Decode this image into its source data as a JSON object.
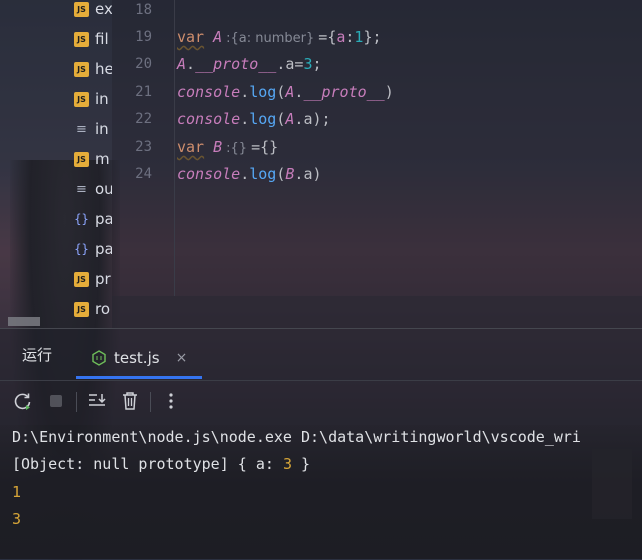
{
  "project_tree": {
    "items": [
      {
        "icon": "js",
        "label": "ex"
      },
      {
        "icon": "js",
        "label": "fil"
      },
      {
        "icon": "js",
        "label": "he"
      },
      {
        "icon": "js",
        "label": "in"
      },
      {
        "icon": "text",
        "label": "in"
      },
      {
        "icon": "js",
        "label": "m"
      },
      {
        "icon": "text",
        "label": "ou"
      },
      {
        "icon": "json",
        "label": "pa"
      },
      {
        "icon": "json",
        "label": "pa"
      },
      {
        "icon": "js",
        "label": "pr"
      },
      {
        "icon": "js",
        "label": "ro"
      }
    ],
    "js_badge": "JS"
  },
  "editor": {
    "line_numbers": [
      "18",
      "19",
      "20",
      "21",
      "22",
      "23",
      "24"
    ],
    "lines": {
      "l19": {
        "kw": "var",
        "name": "A",
        "hint": ":{a: number}",
        "eq": "={",
        "prop": "a",
        "colon": ":",
        "num": "1",
        "tail": "};"
      },
      "l20": {
        "name": "A",
        "dot": ".",
        "proto": "__proto__",
        "dot2": ".",
        "prop": "a",
        "eq": "=",
        "num": "3",
        "tail": ";"
      },
      "l21": {
        "obj": "console",
        "dot": ".",
        "fn": "log",
        "open": "(",
        "name": "A",
        "dot2": ".",
        "proto": "__proto__",
        "close": ")"
      },
      "l22": {
        "obj": "console",
        "dot": ".",
        "fn": "log",
        "open": "(",
        "name": "A",
        "dot2": ".",
        "prop": "a",
        "close": ");"
      },
      "l23": {
        "kw": "var",
        "name": "B",
        "hint": ":{}",
        "eq": "={}"
      },
      "l24": {
        "obj": "console",
        "dot": ".",
        "fn": "log",
        "open": "(",
        "name": "B",
        "dot2": ".",
        "prop": "a",
        "close": ")"
      }
    }
  },
  "run_panel": {
    "title": "运行",
    "tab_label": "test.js",
    "close_symbol": "×",
    "toolbar": {
      "rerun": "rerun-icon",
      "stop": "stop-icon",
      "scroll_to_end": "scroll-to-end-icon",
      "clear": "trash-icon",
      "more": "more-vertical-icon"
    }
  },
  "console": {
    "command": "D:\\Environment\\node.js\\node.exe D:\\data\\writingworld\\vscode_wri",
    "output1_prefix": "[Object: null prototype] { a: ",
    "output1_num": "3",
    "output1_suffix": " }",
    "output2": "1",
    "output3": "3"
  },
  "colors": {
    "keyword": "#cf8e6d",
    "variable": "#c77dbb",
    "number": "#2aacb8",
    "function": "#56a8f5",
    "accent": "#3574f0",
    "console_number": "#d6a538"
  }
}
